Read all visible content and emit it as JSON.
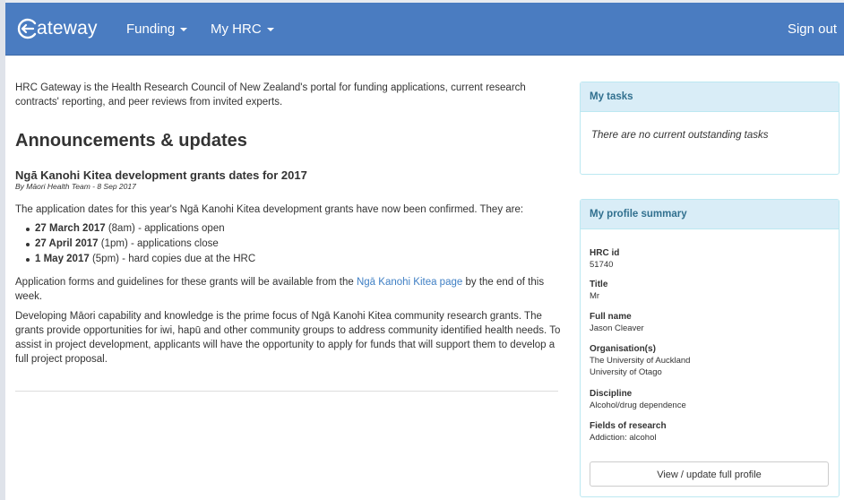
{
  "nav": {
    "brand": "ateway",
    "funding": "Funding",
    "myhrc": "My HRC",
    "signout": "Sign out"
  },
  "intro": "HRC Gateway is the Health Research Council of New Zealand's portal for funding applications, current research contracts' reporting, and peer reviews from invited experts.",
  "announcements": {
    "heading": "Announcements & updates",
    "title": "Ngā Kanohi Kitea development grants dates for 2017",
    "byline": "By Māori Health Team - 8 Sep 2017",
    "p1": "The application dates for this year's Ngā Kanohi Kitea development grants have now been confirmed. They are:",
    "dates": [
      {
        "date": "27 March 2017",
        "time": " (8am)",
        "text": " - applications open"
      },
      {
        "date": "27 April 2017",
        "time": " (1pm)",
        "text": " - applications close"
      },
      {
        "date": "1 May 2017",
        "time": " (5pm)",
        "text": " - hard copies due at the HRC"
      }
    ],
    "p2_before": "Application forms and guidelines for these grants will be available from the ",
    "p2_link": "Ngā Kanohi Kitea page",
    "p2_after": " by the end of this week.",
    "p3": "Developing Māori capability and knowledge is the prime focus of Ngā Kanohi Kitea community research grants. The grants provide opportunities for iwi, hapū and other community groups to address community identified health needs. To assist in project development, applicants will have the opportunity to apply for funds that will support them to develop a full project proposal."
  },
  "tasks": {
    "heading": "My tasks",
    "empty": "There are no current outstanding tasks"
  },
  "profile": {
    "heading": "My profile summary",
    "hrc_id_label": "HRC id",
    "hrc_id": "51740",
    "title_label": "Title",
    "title": "Mr",
    "fullname_label": "Full name",
    "fullname": "Jason Cleaver",
    "org_label": "Organisation(s)",
    "org1": "The University of Auckland",
    "org2": "University of Otago",
    "discipline_label": "Discipline",
    "discipline": "Alcohol/drug dependence",
    "fields_label": "Fields of research",
    "fields": "Addiction: alcohol",
    "button": "View / update full profile"
  },
  "colors": {
    "navbar": "#4a7cc1",
    "link": "#3f7fc4",
    "panel_heading_bg": "#d9edf7",
    "panel_heading_text": "#31708f"
  },
  "icons": {
    "brand": "gateway-arrow-logo-icon",
    "dropdown": "caret-down-icon"
  }
}
